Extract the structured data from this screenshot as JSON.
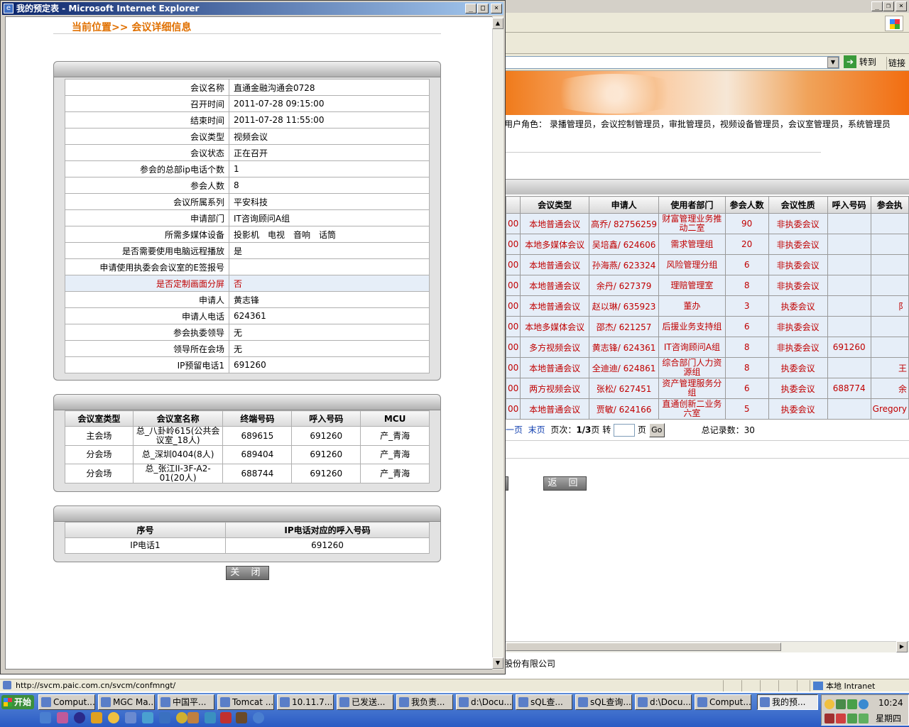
{
  "background_window": {
    "address_go": "转到",
    "links": "链接",
    "roles_text": "用户角色： 录播管理员，会议控制管理员，审批管理员，视频设备管理员，会议室管理员，系统管理员",
    "table": {
      "headers": [
        "会议类型",
        "申请人",
        "使用者部门",
        "参会人数",
        "会议性质",
        "呼入号码",
        "参会执"
      ],
      "rows": [
        {
          "prefix": "00",
          "type": "本地普通会议",
          "applicant": "高乔/ 82756259",
          "dept": "财富管理业务推动二室",
          "count": "90",
          "nature": "非执委会议",
          "dial": "",
          "extra": ""
        },
        {
          "prefix": "00",
          "type": "本地多媒体会议",
          "applicant": "吴培鑫/ 624606",
          "dept": "需求管理组",
          "count": "20",
          "nature": "非执委会议",
          "dial": "",
          "extra": ""
        },
        {
          "prefix": "00",
          "type": "本地普通会议",
          "applicant": "孙海燕/ 623324",
          "dept": "风险管理分组",
          "count": "6",
          "nature": "非执委会议",
          "dial": "",
          "extra": ""
        },
        {
          "prefix": "00",
          "type": "本地普通会议",
          "applicant": "余丹/ 627379",
          "dept": "理赔管理室",
          "count": "8",
          "nature": "非执委会议",
          "dial": "",
          "extra": ""
        },
        {
          "prefix": "00",
          "type": "本地普通会议",
          "applicant": "赵以琳/ 635923",
          "dept": "董办",
          "count": "3",
          "nature": "执委会议",
          "dial": "",
          "extra": "阝"
        },
        {
          "prefix": "00",
          "type": "本地多媒体会议",
          "applicant": "邵杰/ 621257",
          "dept": "后援业务支持组",
          "count": "6",
          "nature": "非执委会议",
          "dial": "",
          "extra": ""
        },
        {
          "prefix": "00",
          "type": "多方视频会议",
          "applicant": "黄志锋/ 624361",
          "dept": "IT咨询顾问A组",
          "count": "8",
          "nature": "非执委会议",
          "dial": "691260",
          "extra": ""
        },
        {
          "prefix": "00",
          "type": "本地普通会议",
          "applicant": "全迪迪/ 624861",
          "dept": "综合部门人力资源组",
          "count": "8",
          "nature": "执委会议",
          "dial": "",
          "extra": "王"
        },
        {
          "prefix": "00",
          "type": "两方视频会议",
          "applicant": "张松/ 627451",
          "dept": "资产管理服务分组",
          "count": "6",
          "nature": "执委会议",
          "dial": "688774",
          "extra": "余"
        },
        {
          "prefix": "00",
          "type": "本地普通会议",
          "applicant": "贾敏/ 624166",
          "dept": "直通创新二业务六室",
          "count": "5",
          "nature": "执委会议",
          "dial": "",
          "extra": "Gregory"
        }
      ]
    },
    "pager": {
      "prev": "一页",
      "last": "末页",
      "page_label": "页次：",
      "page_value": "1/3",
      "page_suffix": "页 转",
      "goto_suffix": "页",
      "go": "Go",
      "total": "总记录数：30"
    },
    "back_button": "返 回",
    "footer": "股份有限公司"
  },
  "popup": {
    "title": "我的预定表 - Microsoft Internet Explorer",
    "breadcrumb": "当前位置>> 会议详细信息",
    "details": [
      {
        "label": "会议名称",
        "value": "直通金融沟通会0728"
      },
      {
        "label": "召开时间",
        "value": "2011-07-28 09:15:00"
      },
      {
        "label": "结束时间",
        "value": "2011-07-28 11:55:00"
      },
      {
        "label": "会议类型",
        "value": "视频会议"
      },
      {
        "label": "会议状态",
        "value": "正在召开"
      },
      {
        "label": "参会的总部ip电话个数",
        "value": "1"
      },
      {
        "label": "参会人数",
        "value": "8"
      },
      {
        "label": "会议所属系列",
        "value": "平安科技"
      },
      {
        "label": "申请部门",
        "value": "IT咨询顾问A组"
      },
      {
        "label": "所需多媒体设备",
        "value": "投影机　电视　音响　话筒"
      },
      {
        "label": "是否需要使用电脑远程播放",
        "value": "是"
      },
      {
        "label": "申请使用执委会会议室的E签报号",
        "value": ""
      },
      {
        "label": "是否定制画面分屏",
        "value": "否"
      },
      {
        "label": "申请人",
        "value": "黄志锋"
      },
      {
        "label": "申请人电话",
        "value": "624361"
      },
      {
        "label": "参会执委领导",
        "value": "无"
      },
      {
        "label": "领导所在会场",
        "value": "无"
      },
      {
        "label": "IP预留电话1",
        "value": "691260"
      }
    ],
    "rooms": {
      "headers": [
        "会议室类型",
        "会议室名称",
        "终端号码",
        "呼入号码",
        "MCU"
      ],
      "rows": [
        [
          "主会场",
          "总_八卦岭615(公共会议室_18人)",
          "689615",
          "691260",
          "产_青海"
        ],
        [
          "分会场",
          "总_深圳0404(8人)",
          "689404",
          "691260",
          "产_青海"
        ],
        [
          "分会场",
          "总_张江II-3F-A2-01(20人)",
          "688744",
          "691260",
          "产_青海"
        ]
      ]
    },
    "ip": {
      "headers": [
        "序号",
        "IP电话对应的呼入号码"
      ],
      "rows": [
        [
          "IP电话1",
          "691260"
        ]
      ]
    },
    "close_button": "关 闭"
  },
  "statusbar": {
    "url": "http://svcm.paic.com.cn/svcm/confmngt/",
    "zone": "本地 Intranet"
  },
  "taskbar": {
    "start": "开始",
    "tasks": [
      "Comput...",
      "MGC Ma...",
      "中国平...",
      "Tomcat ...",
      "10.11.7...",
      "已发送...",
      "我负责...",
      "d:\\Docu...",
      "sQL查...",
      "sQL查询...",
      "d:\\Docu...",
      "Comput...",
      "我的预..."
    ],
    "clock": "10:24",
    "weekday": "星期四"
  }
}
